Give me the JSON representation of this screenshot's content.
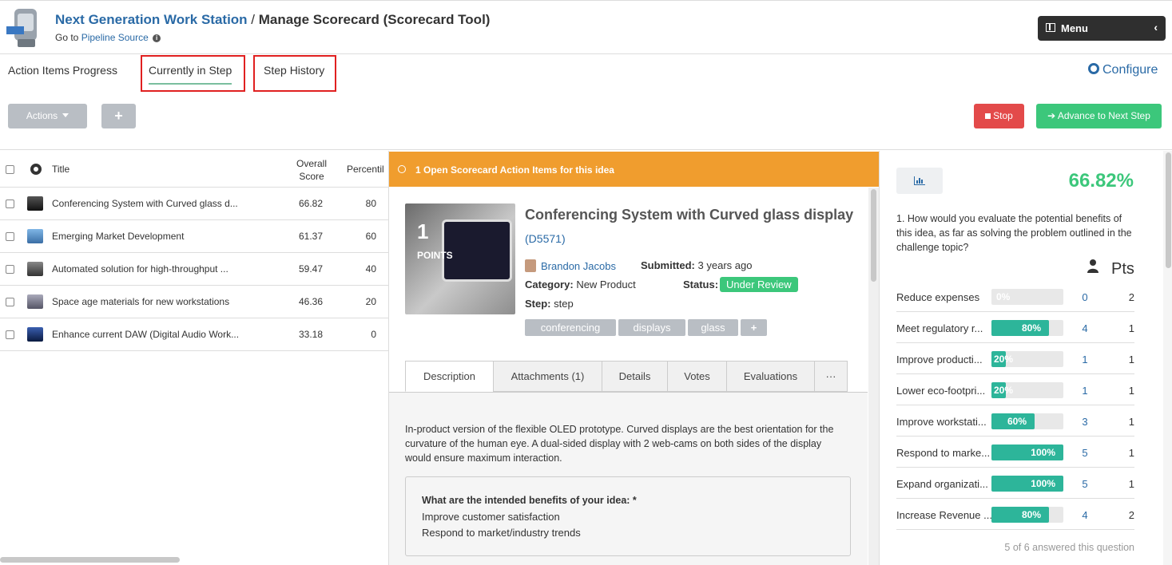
{
  "header": {
    "app_title": "Next Generation Work Station",
    "separator": " / ",
    "page_title": "Manage Scorecard (Scorecard Tool)",
    "goto_prefix": "Go to ",
    "goto_link": "Pipeline Source",
    "menu_label": "Menu",
    "menu_chevron": "‹"
  },
  "tabs": {
    "progress": "Action Items Progress",
    "current": "Currently in Step",
    "history": "Step History",
    "configure": "Configure"
  },
  "toolbar": {
    "actions_label": "Actions",
    "add_label": "+",
    "stop_label": "Stop",
    "advance_label": "➔ Advance to Next Step"
  },
  "list": {
    "col_title": "Title",
    "col_overall_1": "Overall",
    "col_overall_2": "Score",
    "col_percentile": "Percentil",
    "rows": [
      {
        "title": "Conferencing System with Curved glass d...",
        "score": "66.82",
        "percentile": "80"
      },
      {
        "title": "Emerging Market Development",
        "score": "61.37",
        "percentile": "60"
      },
      {
        "title": "Automated solution for high-throughput ...",
        "score": "59.47",
        "percentile": "40"
      },
      {
        "title": "Space age materials for new workstations",
        "score": "46.36",
        "percentile": "20"
      },
      {
        "title": "Enhance current DAW (Digital Audio Work...",
        "score": "33.18",
        "percentile": "0"
      }
    ]
  },
  "idea": {
    "alert": "1 Open Scorecard Action Items for this idea",
    "points_num": "1",
    "points_label": "POINTS",
    "title": "Conferencing System with Curved glass display",
    "id_open": "(",
    "id": "D5571",
    "id_close": ")",
    "author": "Brandon Jacobs",
    "submitted_label": "Submitted:",
    "submitted_value": "3 years ago",
    "category_label": "Category:",
    "category_value": "New Product",
    "status_label": "Status:",
    "status_value": "Under Review",
    "step_label": "Step:",
    "step_value": "step",
    "tags": [
      "conferencing",
      "displays",
      "glass",
      "+"
    ],
    "detail_tabs": [
      "Description",
      "Attachments (1)",
      "Details",
      "Votes",
      "Evaluations",
      "···"
    ],
    "description": "In-product version of the flexible OLED prototype.  Curved displays are the best orientation for the curvature of the human eye.  A dual-sided display with 2 web-cams on both sides of the display would ensure maximum interaction.",
    "benefits_question": "What are the intended benefits of your idea: *",
    "benefit_1": "Improve customer satisfaction",
    "benefit_2": "Respond to market/industry trends"
  },
  "scorecard": {
    "total": "66.82%",
    "question": "1. How would you evaluate the potential benefits of this idea, as far as solving the problem outlined in the challenge topic?",
    "pts_header": "Pts",
    "rows": [
      {
        "label": "Reduce expenses",
        "pct": 0,
        "pct_text": "0%",
        "value": "0",
        "pts": "2"
      },
      {
        "label": "Meet regulatory r...",
        "pct": 80,
        "pct_text": "80%",
        "value": "4",
        "pts": "1"
      },
      {
        "label": "Improve producti...",
        "pct": 20,
        "pct_text": "20%",
        "value": "1",
        "pts": "1"
      },
      {
        "label": "Lower eco-footpri...",
        "pct": 20,
        "pct_text": "20%",
        "value": "1",
        "pts": "1"
      },
      {
        "label": "Improve workstati...",
        "pct": 60,
        "pct_text": "60%",
        "value": "3",
        "pts": "1"
      },
      {
        "label": "Respond to marke...",
        "pct": 100,
        "pct_text": "100%",
        "value": "5",
        "pts": "1"
      },
      {
        "label": "Expand organizati...",
        "pct": 100,
        "pct_text": "100%",
        "value": "5",
        "pts": "1"
      },
      {
        "label": "Increase Revenue ...",
        "pct": 80,
        "pct_text": "80%",
        "value": "4",
        "pts": "2"
      }
    ],
    "answered": "5 of 6 answered this question"
  },
  "colors": {
    "accent_blue": "#2a6aa6",
    "success_green": "#3cc77b",
    "bar_teal": "#2db59a",
    "alert_orange": "#f09d2e",
    "stop_red": "#e34a4a"
  }
}
